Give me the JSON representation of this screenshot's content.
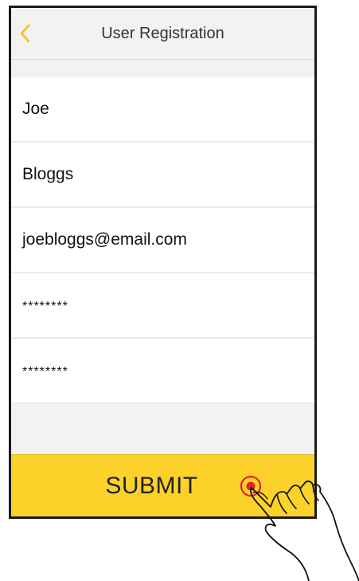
{
  "header": {
    "title": "User Registration",
    "back_icon": "chevron-left-icon"
  },
  "form": {
    "fields": [
      {
        "value": "Joe"
      },
      {
        "value": "Bloggs"
      },
      {
        "value": "joebloggs@email.com"
      },
      {
        "value": "********"
      },
      {
        "value": "********"
      }
    ]
  },
  "submit": {
    "label": "SUBMIT"
  },
  "colors": {
    "accent": "#fcd22a",
    "back_icon": "#f4c31c",
    "tap_indicator": "#e8202a"
  }
}
